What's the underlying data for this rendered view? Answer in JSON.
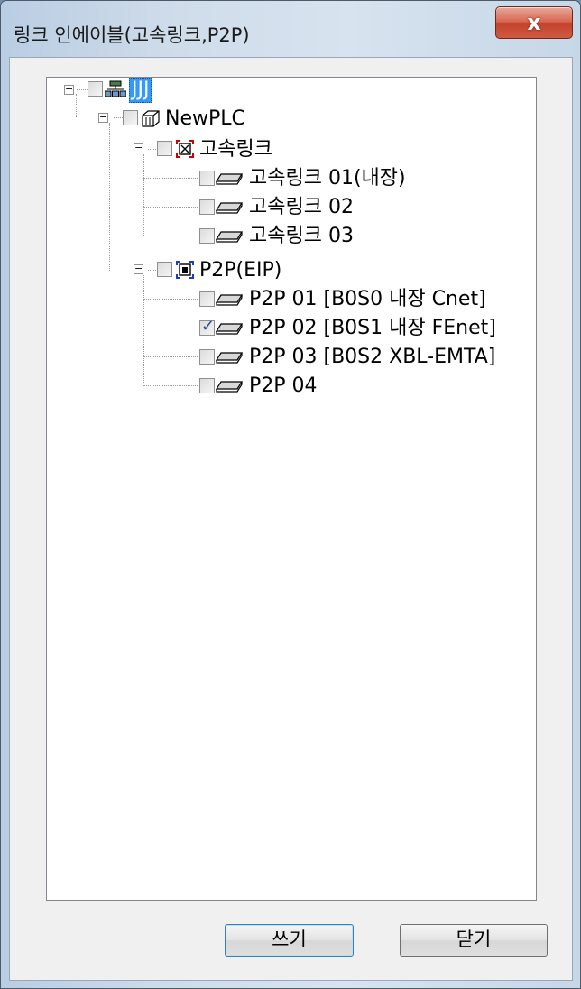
{
  "window": {
    "title": "링크 인에이블(고속링크,P2P)",
    "close_glyph": "x"
  },
  "tree": {
    "root": {
      "label": "JJJ",
      "checked": false,
      "selected": true,
      "icon": "network-icon"
    },
    "plc": {
      "label": "NewPLC",
      "checked": false,
      "icon": "plc-icon"
    },
    "groups": [
      {
        "label": "고속링크",
        "checked": false,
        "icon": "highspeed-link-icon",
        "accent": "#cc0000",
        "items": [
          {
            "label": "고속링크 01(내장)",
            "checked": false
          },
          {
            "label": "고속링크 02",
            "checked": false
          },
          {
            "label": "고속링크 03",
            "checked": false
          }
        ]
      },
      {
        "label": "P2P(EIP)",
        "checked": false,
        "icon": "p2p-icon",
        "accent": "#1a3ccc",
        "items": [
          {
            "label": "P2P 01 [B0S0 내장 Cnet]",
            "checked": false
          },
          {
            "label": "P2P 02 [B0S1 내장 FEnet]",
            "checked": true
          },
          {
            "label": "P2P 03 [B0S2 XBL-EMTA]",
            "checked": false
          },
          {
            "label": "P2P 04",
            "checked": false
          }
        ]
      }
    ]
  },
  "buttons": {
    "write_label": "쓰기",
    "close_label": "닫기"
  }
}
